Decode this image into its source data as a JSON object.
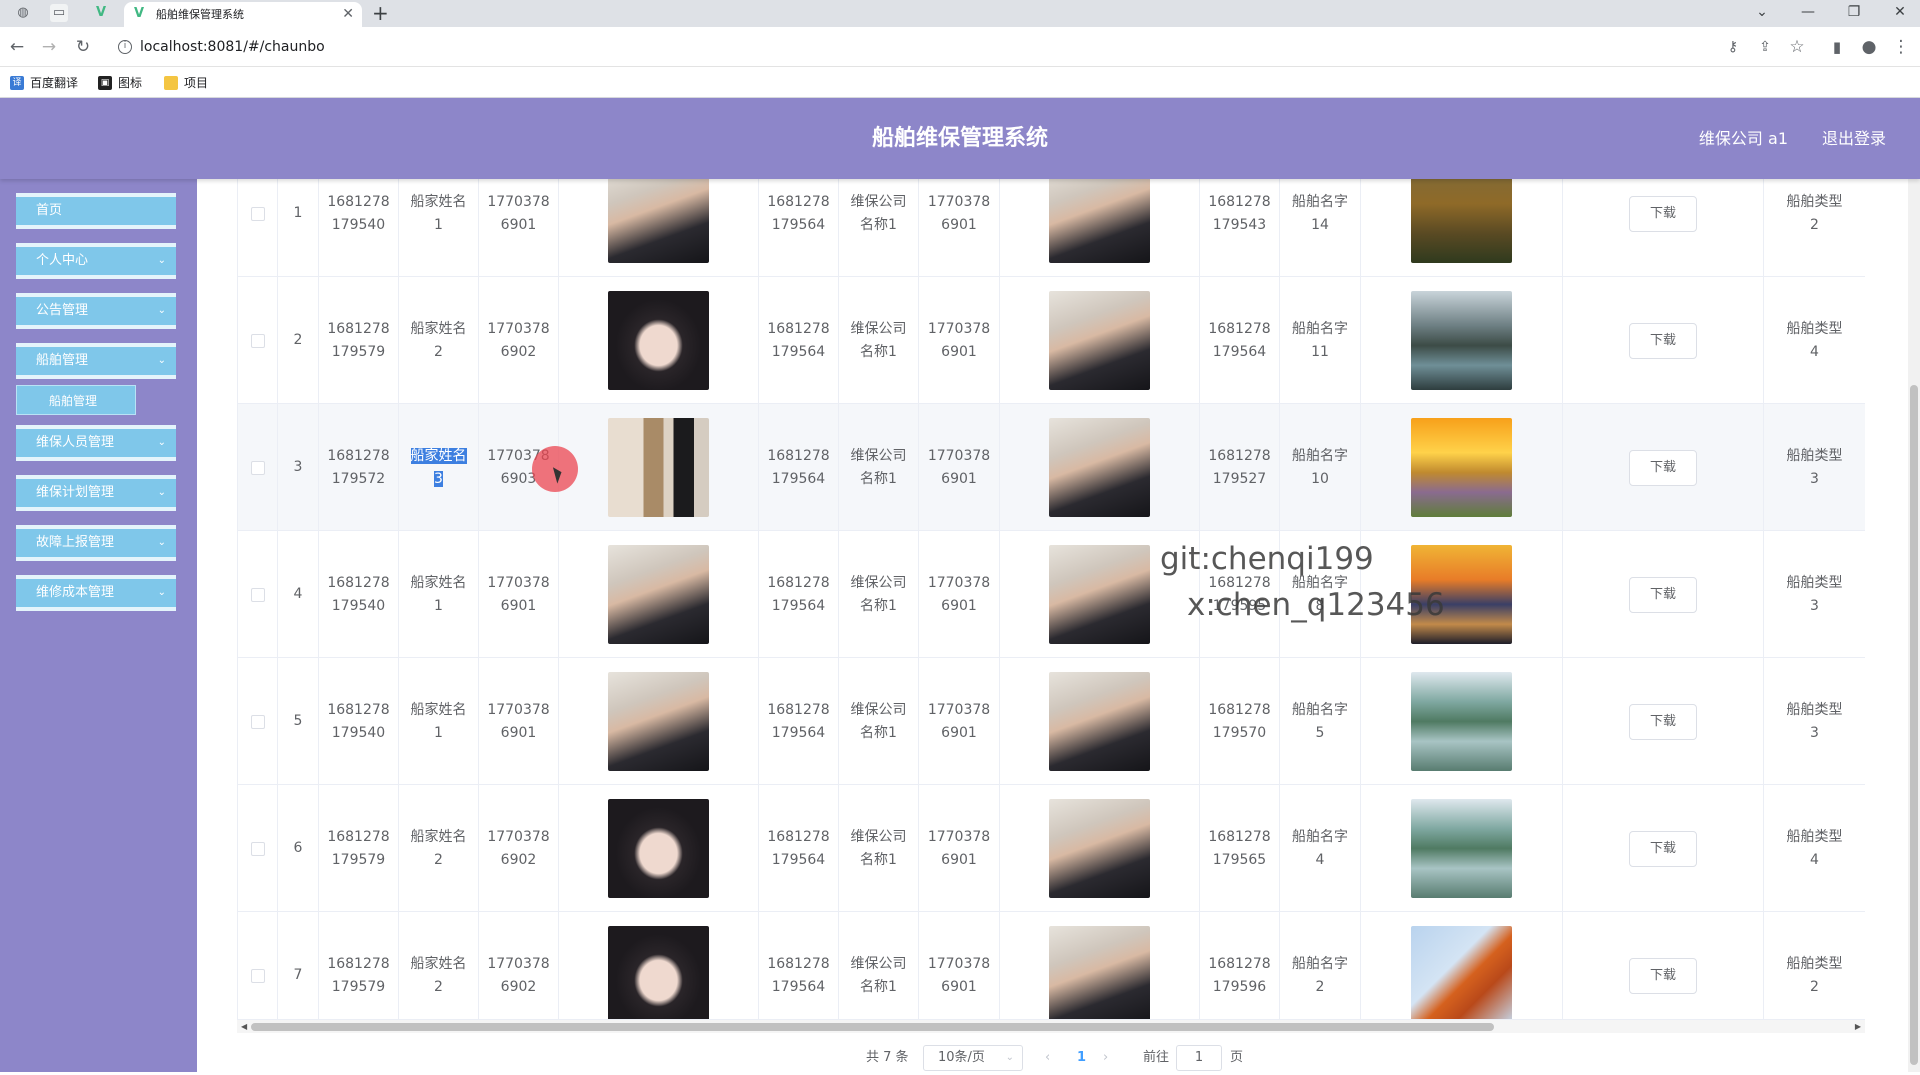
{
  "browser": {
    "tab_title": "船舶维保管理系统",
    "url": "localhost:8081/#/chaunbo",
    "bookmarks": [
      "百度翻译",
      "图标",
      "项目"
    ]
  },
  "header": {
    "title": "船舶维保管理系统",
    "user": "维保公司 a1",
    "logout": "退出登录"
  },
  "sidebar": {
    "items": [
      {
        "label": "首页",
        "has_children": false
      },
      {
        "label": "个人中心",
        "has_children": true
      },
      {
        "label": "公告管理",
        "has_children": true
      },
      {
        "label": "船舶管理",
        "has_children": true
      },
      {
        "label": "船舶管理",
        "sub": true
      },
      {
        "label": "维保人员管理",
        "has_children": true
      },
      {
        "label": "维保计划管理",
        "has_children": true
      },
      {
        "label": "故障上报管理",
        "has_children": true
      },
      {
        "label": "维修成本管理",
        "has_children": true
      }
    ]
  },
  "table": {
    "download_label": "下载",
    "rows": [
      {
        "index": "1",
        "c1": "1681278\n179540",
        "c2": "船家姓名\n1",
        "c3": "1770378\n6901",
        "img1": "photo-man",
        "c4": "1681278\n179564",
        "c5": "维保公司\n名称1",
        "c6": "1770378\n6901",
        "img2": "photo-man",
        "c7": "1681278\n179543",
        "c8": "船舶名字\n14",
        "img3": "landscape-autumn",
        "c9": "船舶类型\n2"
      },
      {
        "index": "2",
        "c1": "1681278\n179579",
        "c2": "船家姓名\n2",
        "c3": "1770378\n6902",
        "img1": "photo-woman",
        "c4": "1681278\n179564",
        "c5": "维保公司\n名称1",
        "c6": "1770378\n6901",
        "img2": "photo-man",
        "c7": "1681278\n179564",
        "c8": "船舶名字\n11",
        "img3": "landscape-lake-town",
        "c9": "船舶类型\n4"
      },
      {
        "index": "3",
        "c1": "1681278\n179572",
        "c2": "船家姓名\n3",
        "c3": "1770378\n6903",
        "img1": "photo-gallery",
        "c4": "1681278\n179564",
        "c5": "维保公司\n名称1",
        "c6": "1770378\n6901",
        "img2": "photo-man",
        "c7": "1681278\n179527",
        "c8": "船舶名字\n10",
        "img3": "landscape-sunset-field",
        "c9": "船舶类型\n3"
      },
      {
        "index": "4",
        "c1": "1681278\n179540",
        "c2": "船家姓名\n1",
        "c3": "1770378\n6901",
        "img1": "photo-man",
        "c4": "1681278\n179564",
        "c5": "维保公司\n名称1",
        "c6": "1770378\n6901",
        "img2": "photo-man",
        "c7": "1681278\n179595",
        "c8": "船舶名字\n8",
        "img3": "landscape-beach-sunset",
        "c9": "船舶类型\n3"
      },
      {
        "index": "5",
        "c1": "1681278\n179540",
        "c2": "船家姓名\n1",
        "c3": "1770378\n6901",
        "img1": "photo-man",
        "c4": "1681278\n179564",
        "c5": "维保公司\n名称1",
        "c6": "1770378\n6901",
        "img2": "photo-man",
        "c7": "1681278\n179570",
        "c8": "船舶名字\n5",
        "img3": "landscape-karst-river",
        "c9": "船舶类型\n3"
      },
      {
        "index": "6",
        "c1": "1681278\n179579",
        "c2": "船家姓名\n2",
        "c3": "1770378\n6902",
        "img1": "photo-woman",
        "c4": "1681278\n179564",
        "c5": "维保公司\n名称1",
        "c6": "1770378\n6901",
        "img2": "photo-man",
        "c7": "1681278\n179565",
        "c8": "船舶名字\n4",
        "img3": "landscape-karst-river",
        "c9": "船舶类型\n4"
      },
      {
        "index": "7",
        "c1": "1681278\n179579",
        "c2": "船家姓名\n2",
        "c3": "1770378\n6902",
        "img1": "photo-woman",
        "c4": "1681278\n179564",
        "c5": "维保公司\n名称1",
        "c6": "1770378\n6901",
        "img2": "photo-man",
        "c7": "1681278\n179596",
        "c8": "船舶名字\n2",
        "img3": "landscape-autumn-leaves",
        "c9": "船舶类型\n2"
      }
    ]
  },
  "pagination": {
    "total": "共 7 条",
    "page_size": "10条/页",
    "current_page": "1",
    "goto_label": "前往",
    "goto_value": "1",
    "page_suffix": "页"
  },
  "overlay": {
    "watermark_line1": "git:chenqi199",
    "watermark_line2": "x:chen_q123456"
  },
  "colors": {
    "header_bg": "#8d86c9",
    "menu_bg": "#7fc7ea",
    "accent": "#409eff"
  }
}
